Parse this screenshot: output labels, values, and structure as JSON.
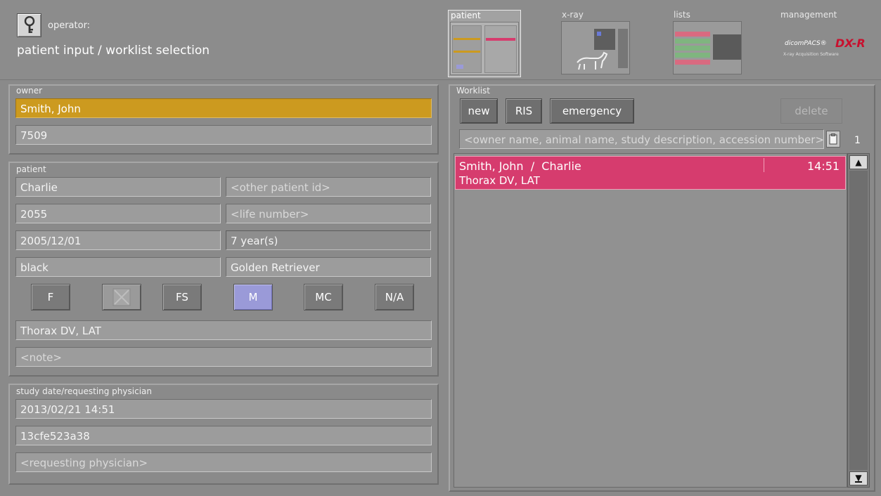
{
  "header": {
    "operator_label": "operator:",
    "title": "patient input / worklist selection",
    "nav": {
      "patient": "patient",
      "xray": "x-ray",
      "lists": "lists",
      "management": "management"
    },
    "brand": {
      "name": "dicomPACS®",
      "product": "DX-R",
      "tagline": "X-ray Acquisition Software"
    }
  },
  "owner": {
    "legend": "owner",
    "name": "Smith, John",
    "id": "7509"
  },
  "patient": {
    "legend": "patient",
    "name": "Charlie",
    "other_id_placeholder": "<other patient id>",
    "id": "2055",
    "life_number_placeholder": "<life number>",
    "birth_date": "2005/12/01",
    "age": "7 year(s)",
    "color": "black",
    "breed": "Golden Retriever",
    "sex_options": [
      "F",
      "",
      "FS",
      "M",
      "MC",
      "N/A"
    ],
    "sex_selected": "M",
    "study_description": "Thorax DV, LAT",
    "note_placeholder": "<note>"
  },
  "study": {
    "legend": "study date/requesting physician",
    "date": "2013/02/21 14:51",
    "accession": "13cfe523a38",
    "physician_placeholder": "<requesting physician>"
  },
  "worklist": {
    "legend": "Worklist",
    "new_label": "new",
    "ris_label": "RIS",
    "emergency_label": "emergency",
    "delete_label": "delete",
    "search_placeholder": "<owner name, animal name, study description, accession number>",
    "count": "1",
    "items": [
      {
        "title": "Smith, John  /  Charlie",
        "time": "14:51",
        "description": "Thorax DV, LAT"
      }
    ]
  },
  "colors": {
    "highlight": "#cc9a1f",
    "selected_sex": "#9a9ad8",
    "worklist_row": "#d63c6e"
  }
}
